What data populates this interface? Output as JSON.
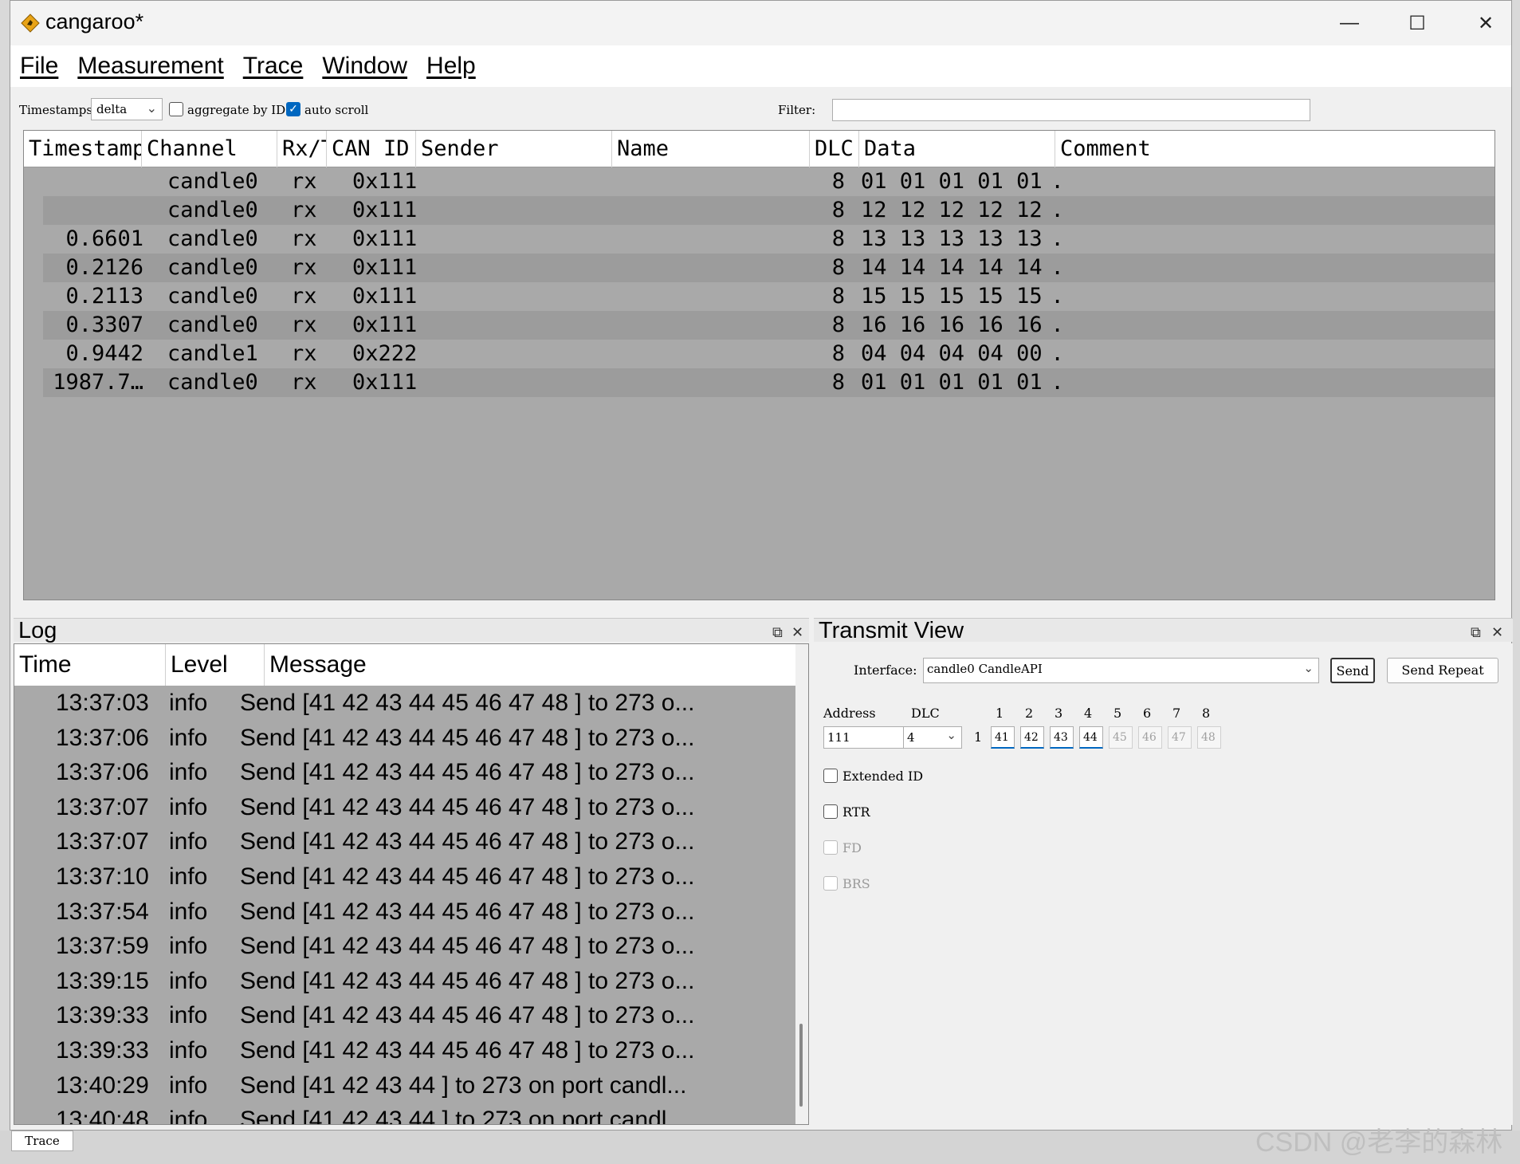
{
  "window": {
    "title": "cangaroo*",
    "controls": {
      "minimize": "—",
      "maximize": "☐",
      "close": "✕"
    }
  },
  "menu": [
    "File",
    "Measurement",
    "Trace",
    "Window",
    "Help"
  ],
  "toolbar": {
    "timestamps_label": "Timestamps:",
    "timestamps_value": "delta",
    "aggregate_label": "aggregate by ID",
    "aggregate_checked": false,
    "autoscroll_label": "auto scroll",
    "autoscroll_checked": true,
    "filter_label": "Filter:",
    "filter_value": ""
  },
  "trace": {
    "columns": [
      "Timestamp",
      "Channel",
      "Rx/T",
      "CAN ID",
      "Sender",
      "Name",
      "DLC",
      "Data",
      "Comment"
    ],
    "rows": [
      {
        "timestamp": "",
        "channel": "candle0",
        "dir": "rx",
        "id": "0x111",
        "sender": "",
        "name": "",
        "dlc": "8",
        "data": "01 01 01 01 01 …",
        "comment": ""
      },
      {
        "timestamp": "",
        "channel": "candle0",
        "dir": "rx",
        "id": "0x111",
        "sender": "",
        "name": "",
        "dlc": "8",
        "data": "12 12 12 12 12 …",
        "comment": ""
      },
      {
        "timestamp": "0.6601",
        "channel": "candle0",
        "dir": "rx",
        "id": "0x111",
        "sender": "",
        "name": "",
        "dlc": "8",
        "data": "13 13 13 13 13 …",
        "comment": ""
      },
      {
        "timestamp": "0.2126",
        "channel": "candle0",
        "dir": "rx",
        "id": "0x111",
        "sender": "",
        "name": "",
        "dlc": "8",
        "data": "14 14 14 14 14 …",
        "comment": ""
      },
      {
        "timestamp": "0.2113",
        "channel": "candle0",
        "dir": "rx",
        "id": "0x111",
        "sender": "",
        "name": "",
        "dlc": "8",
        "data": "15 15 15 15 15 …",
        "comment": ""
      },
      {
        "timestamp": "0.3307",
        "channel": "candle0",
        "dir": "rx",
        "id": "0x111",
        "sender": "",
        "name": "",
        "dlc": "8",
        "data": "16 16 16 16 16 …",
        "comment": ""
      },
      {
        "timestamp": "0.9442",
        "channel": "candle1",
        "dir": "rx",
        "id": "0x222",
        "sender": "",
        "name": "",
        "dlc": "8",
        "data": "04 04 04 04 00 …",
        "comment": ""
      },
      {
        "timestamp": "1987.7…",
        "channel": "candle0",
        "dir": "rx",
        "id": "0x111",
        "sender": "",
        "name": "",
        "dlc": "8",
        "data": "01 01 01 01 01 …",
        "comment": ""
      }
    ]
  },
  "log": {
    "title": "Log",
    "columns": [
      "Time",
      "Level",
      "Message"
    ],
    "rows": [
      {
        "time": "13:37:03",
        "level": "info",
        "message": "Send [41 42 43 44 45 46 47 48 ] to 273 o..."
      },
      {
        "time": "13:37:06",
        "level": "info",
        "message": "Send [41 42 43 44 45 46 47 48 ] to 273 o..."
      },
      {
        "time": "13:37:06",
        "level": "info",
        "message": "Send [41 42 43 44 45 46 47 48 ] to 273 o..."
      },
      {
        "time": "13:37:07",
        "level": "info",
        "message": "Send [41 42 43 44 45 46 47 48 ] to 273 o..."
      },
      {
        "time": "13:37:07",
        "level": "info",
        "message": "Send [41 42 43 44 45 46 47 48 ] to 273 o..."
      },
      {
        "time": "13:37:10",
        "level": "info",
        "message": "Send [41 42 43 44 45 46 47 48 ] to 273 o..."
      },
      {
        "time": "13:37:54",
        "level": "info",
        "message": "Send [41 42 43 44 45 46 47 48 ] to 273 o..."
      },
      {
        "time": "13:37:59",
        "level": "info",
        "message": "Send [41 42 43 44 45 46 47 48 ] to 273 o..."
      },
      {
        "time": "13:39:15",
        "level": "info",
        "message": "Send [41 42 43 44 45 46 47 48 ] to 273 o..."
      },
      {
        "time": "13:39:33",
        "level": "info",
        "message": "Send [41 42 43 44 45 46 47 48 ] to 273 o..."
      },
      {
        "time": "13:39:33",
        "level": "info",
        "message": "Send [41 42 43 44 45 46 47 48 ] to 273 o..."
      },
      {
        "time": "13:40:29",
        "level": "info",
        "message": "Send [41 42 43 44 ] to 273 on port candl..."
      },
      {
        "time": "13:40:48",
        "level": "info",
        "message": "Send [41 42 43 44 ] to 273 on port candl..."
      }
    ]
  },
  "transmit": {
    "title": "Transmit View",
    "interface_label": "Interface:",
    "interface_value": "candle0 CandleAPI",
    "send_label": "Send",
    "send_repeat_label": "Send Repeat",
    "address_label": "Address",
    "address_value": "111",
    "dlc_label": "DLC",
    "dlc_value": "4",
    "byte_headers": [
      "1",
      "2",
      "3",
      "4",
      "5",
      "6",
      "7",
      "8"
    ],
    "row_index": "1",
    "bytes": [
      "41",
      "42",
      "43",
      "44",
      "45",
      "46",
      "47",
      "48"
    ],
    "extended_id_label": "Extended ID",
    "rtr_label": "RTR",
    "fd_label": "FD",
    "brs_label": "BRS"
  },
  "bottom_tab": "Trace",
  "watermark": "CSDN @老李的森林"
}
